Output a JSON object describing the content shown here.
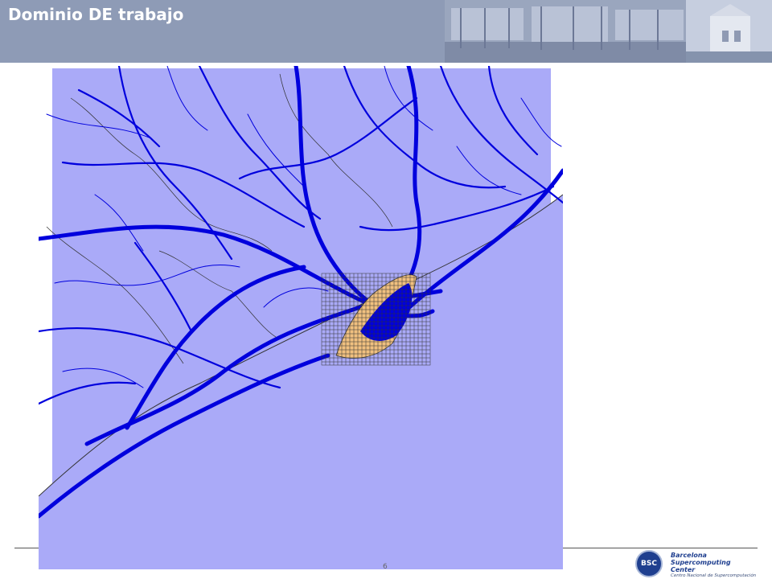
{
  "slide": {
    "title": "Dominio DE trabajo",
    "page_number": "6"
  },
  "logo": {
    "badge": "BSC",
    "line1": "Barcelona",
    "line2": "Supercomputing",
    "line3": "Center",
    "subtitle": "Centro Nacional de Supercomputación"
  },
  "colors": {
    "header": "#8e9bb6",
    "sea": "#aaaaf8",
    "roads": "#0000dd",
    "urban": "#f0c080",
    "brand": "#1f3f8f"
  },
  "icons": [
    "building-photo-icon",
    "bsc-logo-icon"
  ]
}
